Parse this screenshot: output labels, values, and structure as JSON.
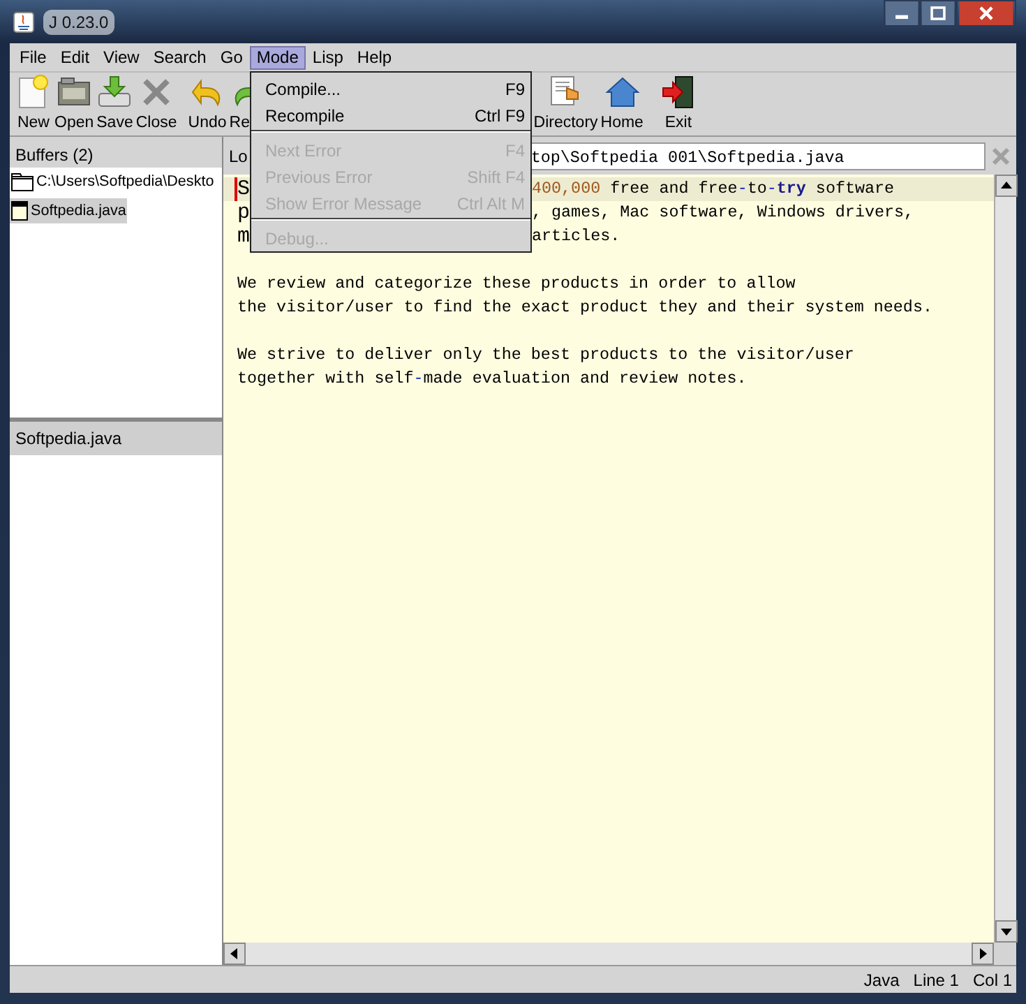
{
  "window": {
    "title": "J 0.23.0"
  },
  "menu_bar": [
    {
      "label": "File",
      "open": false
    },
    {
      "label": "Edit",
      "open": false
    },
    {
      "label": "View",
      "open": false
    },
    {
      "label": "Search",
      "open": false
    },
    {
      "label": "Go",
      "open": false
    },
    {
      "label": "Mode",
      "open": true
    },
    {
      "label": "Lisp",
      "open": false
    },
    {
      "label": "Help",
      "open": false
    }
  ],
  "toolbar": [
    {
      "kind": "new",
      "label": "New"
    },
    {
      "kind": "open",
      "label": "Open"
    },
    {
      "kind": "save",
      "label": "Save"
    },
    {
      "kind": "close",
      "label": "Close"
    },
    {
      "kind": "undo",
      "label": "Undo"
    },
    {
      "kind": "redo",
      "label": "Re"
    },
    {
      "kind": "directory",
      "label": "Directory"
    },
    {
      "kind": "home",
      "label": "Home"
    },
    {
      "kind": "exit",
      "label": "Exit"
    }
  ],
  "buffers": {
    "title": "Buffers (2)",
    "items": [
      {
        "kind": "folder",
        "label": "C:\\Users\\Softpedia\\Deskto",
        "selected": false
      },
      {
        "kind": "file",
        "label": "Softpedia.java",
        "selected": true
      }
    ]
  },
  "lower_panel": {
    "items": [
      {
        "label": "Softpedia.java",
        "selected": true
      }
    ]
  },
  "location": {
    "label": "Lo",
    "value": "top\\Softpedia 001\\Softpedia.java"
  },
  "editor": {
    "lines": [
      {
        "kind": "split",
        "current": true,
        "lead": "S",
        "segments": [
          {
            "kind": "number",
            "text": "400,000"
          },
          {
            "kind": "plain",
            "text": " free and free"
          },
          {
            "kind": "operator",
            "text": "-"
          },
          {
            "kind": "plain",
            "text": "to"
          },
          {
            "kind": "operator",
            "text": "-"
          },
          {
            "kind": "keyword",
            "text": "try"
          },
          {
            "kind": "plain",
            "text": " software"
          }
        ]
      },
      {
        "kind": "split",
        "current": false,
        "lead": "p",
        "segments": [
          {
            "kind": "plain",
            "text": ", games, Mac software, Windows drivers,"
          }
        ]
      },
      {
        "kind": "split",
        "current": false,
        "lead": "m",
        "segments": [
          {
            "kind": "plain",
            "text": "articles."
          }
        ]
      },
      {
        "kind": "blank",
        "current": false
      },
      {
        "kind": "full",
        "current": false,
        "segments": [
          {
            "kind": "plain",
            "text": "We review and categorize these products in order to allow"
          }
        ]
      },
      {
        "kind": "full",
        "current": false,
        "segments": [
          {
            "kind": "plain",
            "text": "the visitor/user to find the exact product they and their system needs."
          }
        ]
      },
      {
        "kind": "blank",
        "current": false
      },
      {
        "kind": "full",
        "current": false,
        "segments": [
          {
            "kind": "plain",
            "text": "We strive to deliver only the best products to the visitor/user"
          }
        ]
      },
      {
        "kind": "full",
        "current": false,
        "segments": [
          {
            "kind": "plain",
            "text": "together with self"
          },
          {
            "kind": "operator",
            "text": "-"
          },
          {
            "kind": "plain",
            "text": "made evaluation and review notes."
          }
        ]
      }
    ]
  },
  "mode_menu": {
    "items": [
      {
        "kind": "item",
        "label": "Compile...",
        "shortcut": "F9",
        "disabled": false
      },
      {
        "kind": "item",
        "label": "Recompile",
        "shortcut": "Ctrl F9",
        "disabled": false
      },
      {
        "kind": "separator"
      },
      {
        "kind": "item",
        "label": "Next Error",
        "shortcut": "F4",
        "disabled": true
      },
      {
        "kind": "item",
        "label": "Previous Error",
        "shortcut": "Shift F4",
        "disabled": true
      },
      {
        "kind": "item",
        "label": "Show Error Message",
        "shortcut": "Ctrl Alt M",
        "disabled": true
      },
      {
        "kind": "separator"
      },
      {
        "kind": "item",
        "label": "Debug...",
        "disabled": true
      }
    ]
  },
  "status_bar": [
    "Java",
    "Line 1",
    "Col 1"
  ]
}
